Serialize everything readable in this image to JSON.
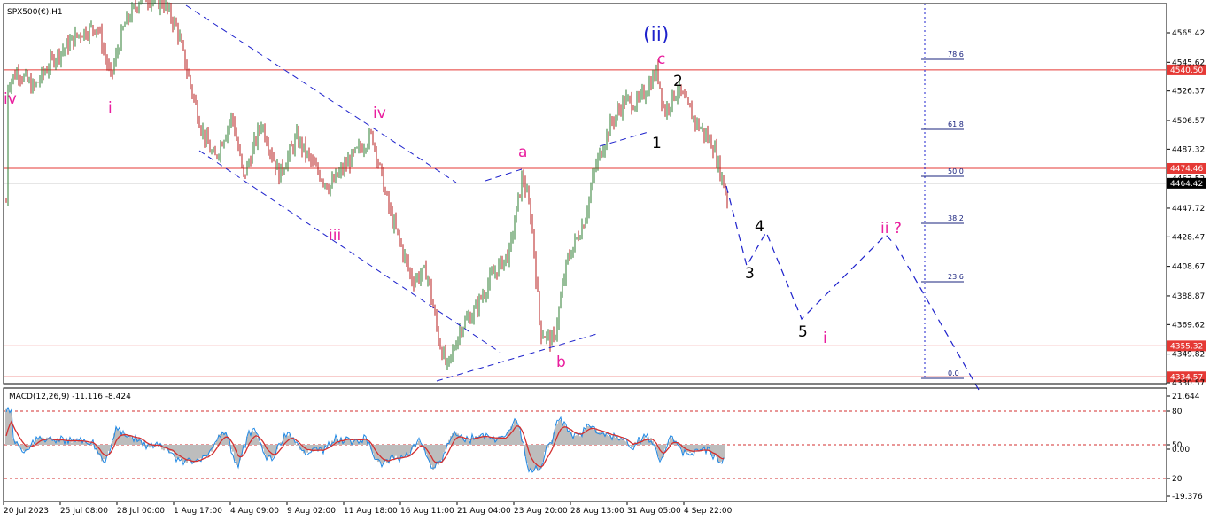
{
  "chart_title": "SPX500(€),H1",
  "macd_title": "MACD(12,26,9) -11.116 -8.424",
  "chart_data": [
    {
      "type": "candlestick",
      "symbol": "SPX500(€)",
      "timeframe": "H1",
      "ylim": [
        4330.57,
        4580
      ],
      "y_ticks": [
        "4565.42",
        "4545.62",
        "4526.37",
        "4506.57",
        "4487.32",
        "4467.52",
        "4447.72",
        "4428.47",
        "4408.67",
        "4388.87",
        "4369.62",
        "4349.82",
        "4330.57"
      ],
      "x_tick_labels": [
        "20 Jul 2023",
        "25 Jul 08:00",
        "28 Jul 00:00",
        "1 Aug 17:00",
        "4 Aug 09:00",
        "9 Aug 02:00",
        "11 Aug 18:00",
        "16 Aug 11:00",
        "21 Aug 04:00",
        "23 Aug 20:00",
        "28 Aug 13:00",
        "31 Aug 05:00",
        "4 Sep 22:00"
      ],
      "last_price": "4464.42",
      "horizontal_levels": [
        {
          "price": 4540.5,
          "label": "4540.50",
          "color": "#e53935"
        },
        {
          "price": 4474.46,
          "label": "4474.46",
          "color": "#e53935"
        },
        {
          "price": 4355.32,
          "label": "4355.32",
          "color": "#e53935"
        },
        {
          "price": 4334.57,
          "label": "4334.57",
          "color": "#e53935"
        }
      ],
      "fibonacci_levels": [
        {
          "label": "78.6"
        },
        {
          "label": "61.8"
        },
        {
          "label": "50.0"
        },
        {
          "label": "38.2"
        },
        {
          "label": "23.6"
        },
        {
          "label": "0.0"
        }
      ],
      "wave_labels": [
        {
          "text": "iv",
          "color": "#e91e9e"
        },
        {
          "text": "i",
          "color": "#e91e9e"
        },
        {
          "text": "iii",
          "color": "#e91e9e"
        },
        {
          "text": "iv",
          "color": "#e91e9e"
        },
        {
          "text": "a",
          "color": "#e91e9e"
        },
        {
          "text": "b",
          "color": "#e91e9e"
        },
        {
          "text": "(ii)",
          "color": "#1e22cc"
        },
        {
          "text": "c",
          "color": "#e91e9e"
        },
        {
          "text": "1",
          "color": "#000000"
        },
        {
          "text": "2",
          "color": "#000000"
        },
        {
          "text": "3",
          "color": "#000000"
        },
        {
          "text": "4",
          "color": "#000000"
        },
        {
          "text": "5",
          "color": "#000000"
        },
        {
          "text": "i",
          "color": "#e91e9e"
        },
        {
          "text": "ii ?",
          "color": "#e91e9e"
        }
      ],
      "colors": {
        "bull": "#2e7d32",
        "bear": "#b71c1c",
        "levels": "#e53935",
        "trendline": "#1e22cc",
        "projection": "#1e22cc"
      }
    },
    {
      "type": "macd",
      "params": "12,26,9",
      "macd": -11.116,
      "signal": -8.424,
      "y_ticks": [
        "21.644",
        "80",
        "50",
        "0.00",
        "20",
        "-19.376"
      ],
      "colors": {
        "histogram": "#bdbdbd",
        "macd": "#1e88e5",
        "signal": "#d32f2f",
        "levels": "#d32f2f"
      }
    }
  ]
}
